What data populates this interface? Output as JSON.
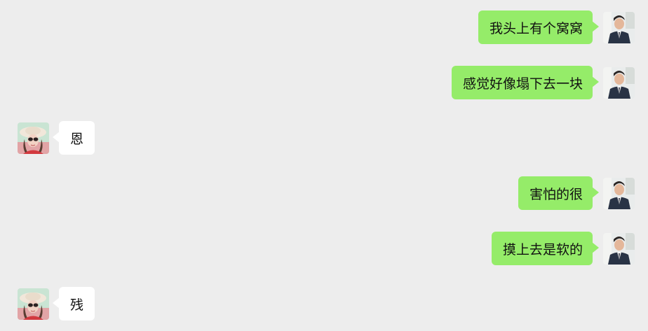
{
  "chat": {
    "messages": [
      {
        "side": "out",
        "text": "我头上有个窝窝",
        "avatar": "avatar-man-in-suit"
      },
      {
        "side": "out",
        "text": "感觉好像塌下去一块",
        "avatar": "avatar-man-in-suit"
      },
      {
        "side": "in",
        "text": "恩",
        "avatar": "avatar-woman-with-hat"
      },
      {
        "side": "out",
        "text": "害怕的很",
        "avatar": "avatar-man-in-suit"
      },
      {
        "side": "out",
        "text": "摸上去是软的",
        "avatar": "avatar-man-in-suit"
      },
      {
        "side": "in",
        "text": "残",
        "avatar": "avatar-woman-with-hat"
      }
    ]
  },
  "colors": {
    "background": "#ededed",
    "outgoing_bubble": "#95ec69",
    "incoming_bubble": "#ffffff",
    "text": "#111111"
  }
}
